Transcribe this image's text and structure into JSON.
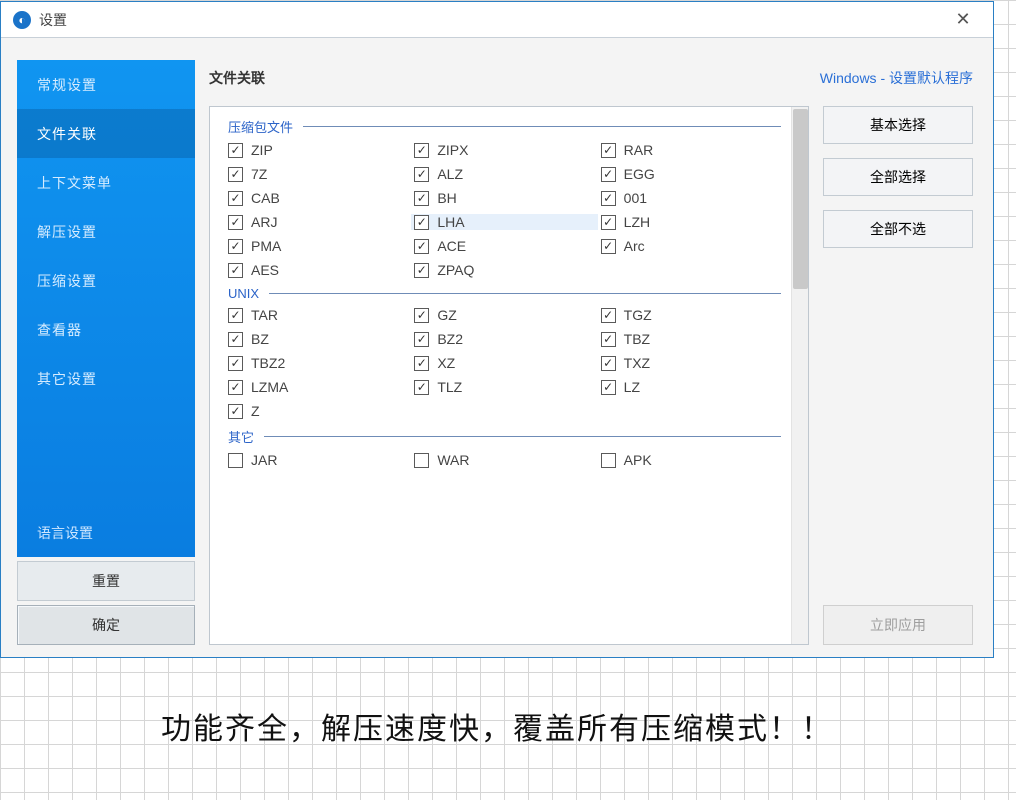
{
  "window": {
    "title": "设置"
  },
  "sidebar": {
    "items": [
      {
        "label": "常规设置"
      },
      {
        "label": "文件关联"
      },
      {
        "label": "上下文菜单"
      },
      {
        "label": "解压设置"
      },
      {
        "label": "压缩设置"
      },
      {
        "label": "查看器"
      },
      {
        "label": "其它设置"
      }
    ],
    "language_label": "语言设置",
    "reset_label": "重置",
    "ok_label": "确定"
  },
  "header": {
    "title": "文件关联",
    "link_prefix": "Windows - ",
    "link_text": "设置默认程序"
  },
  "groups": {
    "g0": {
      "title": "压缩包文件",
      "checked": true,
      "i0": "ZIP",
      "i1": "ZIPX",
      "i2": "RAR",
      "i3": "7Z",
      "i4": "ALZ",
      "i5": "EGG",
      "i6": "CAB",
      "i7": "BH",
      "i8": "001",
      "i9": "ARJ",
      "i10": "LHA",
      "i11": "LZH",
      "i12": "PMA",
      "i13": "ACE",
      "i14": "Arc",
      "i15": "AES",
      "i16": "ZPAQ"
    },
    "g1": {
      "title": "UNIX",
      "checked": true,
      "i0": "TAR",
      "i1": "GZ",
      "i2": "TGZ",
      "i3": "BZ",
      "i4": "BZ2",
      "i5": "TBZ",
      "i6": "TBZ2",
      "i7": "XZ",
      "i8": "TXZ",
      "i9": "LZMA",
      "i10": "TLZ",
      "i11": "LZ",
      "i12": "Z"
    },
    "g2": {
      "title": "其它",
      "checked": false,
      "i0": "JAR",
      "i1": "WAR",
      "i2": "APK"
    }
  },
  "right": {
    "basic": "基本选择",
    "all": "全部选择",
    "none": "全部不选",
    "apply": "立即应用"
  },
  "caption": "功能齐全，解压速度快，覆盖所有压缩模式！！"
}
